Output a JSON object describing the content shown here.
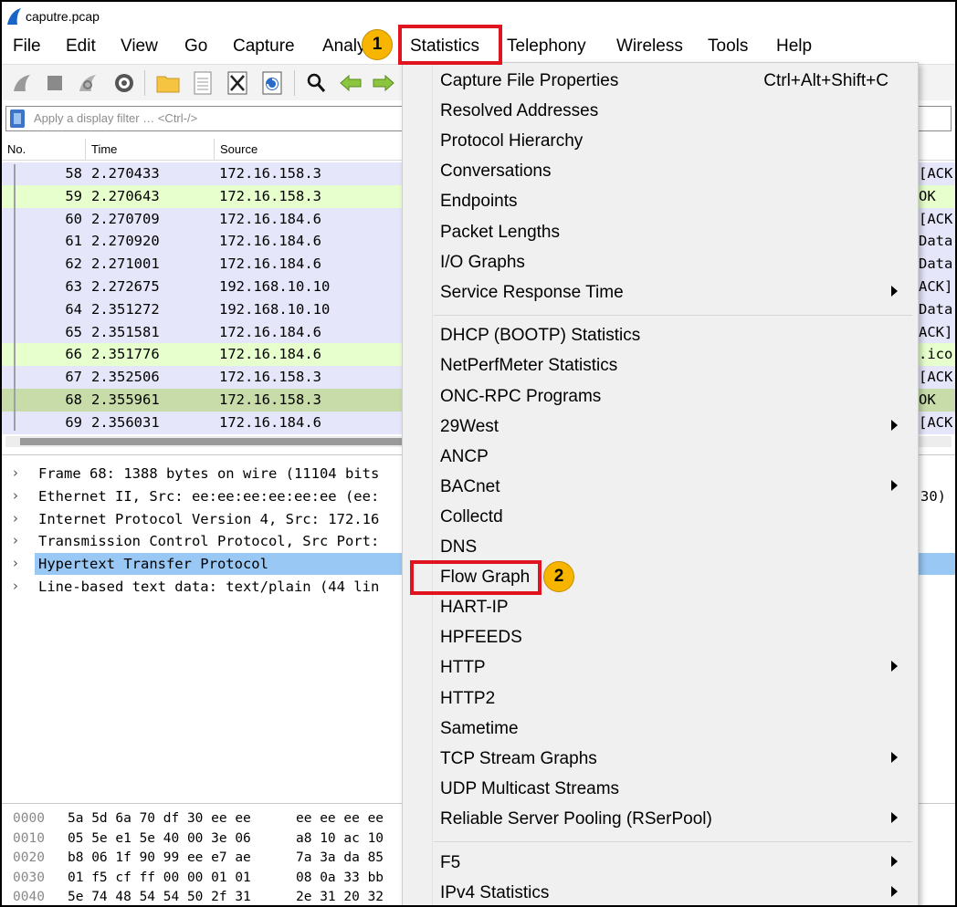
{
  "window": {
    "title": "caputre.pcap"
  },
  "menu": {
    "file": "File",
    "edit": "Edit",
    "view": "View",
    "go": "Go",
    "capture": "Capture",
    "analyze": "Analy",
    "statistics": "Statistics",
    "telephony": "Telephony",
    "wireless": "Wireless",
    "tools": "Tools",
    "help": "Help"
  },
  "filter": {
    "placeholder": "Apply a display filter … <Ctrl-/>"
  },
  "packet_list": {
    "headers": {
      "no": "No.",
      "time": "Time",
      "source": "Source"
    },
    "rows": [
      {
        "no": "58",
        "time": "2.270433",
        "source": "172.16.158.3",
        "info": "[ACK",
        "color": "#e6e6fa"
      },
      {
        "no": "59",
        "time": "2.270643",
        "source": "172.16.158.3",
        "info": "OK",
        "color": "#e6ffcc"
      },
      {
        "no": "60",
        "time": "2.270709",
        "source": "172.16.184.6",
        "info": "[ACK",
        "color": "#e6e6fa"
      },
      {
        "no": "61",
        "time": "2.270920",
        "source": "172.16.184.6",
        "info": "Data",
        "color": "#e6e6fa"
      },
      {
        "no": "62",
        "time": "2.271001",
        "source": "172.16.184.6",
        "info": "Data",
        "color": "#e6e6fa"
      },
      {
        "no": "63",
        "time": "2.272675",
        "source": "192.168.10.10",
        "info": "ACK]",
        "color": "#e6e6fa"
      },
      {
        "no": "64",
        "time": "2.351272",
        "source": "192.168.10.10",
        "info": "Data",
        "color": "#e6e6fa"
      },
      {
        "no": "65",
        "time": "2.351581",
        "source": "172.16.184.6",
        "info": "ACK]",
        "color": "#e6e6fa"
      },
      {
        "no": "66",
        "time": "2.351776",
        "source": "172.16.184.6",
        "info": ".ico",
        "color": "#e6ffcc"
      },
      {
        "no": "67",
        "time": "2.352506",
        "source": "172.16.158.3",
        "info": "[ACK",
        "color": "#e6e6fa"
      },
      {
        "no": "68",
        "time": "2.355961",
        "source": "172.16.158.3",
        "info": "OK",
        "color": "#c8dcaa"
      },
      {
        "no": "69",
        "time": "2.356031",
        "source": "172.16.184.6",
        "info": "[ACK",
        "color": "#e6e6fa"
      }
    ]
  },
  "details": {
    "rows": [
      {
        "text": "Frame 68: 1388 bytes on wire (11104 bits",
        "tail": ""
      },
      {
        "text": "Ethernet II, Src: ee:ee:ee:ee:ee:ee (ee:",
        "tail": "30)"
      },
      {
        "text": "Internet Protocol Version 4, Src: 172.16",
        "tail": ""
      },
      {
        "text": "Transmission Control Protocol, Src Port:",
        "tail": ""
      },
      {
        "text": "Hypertext Transfer Protocol",
        "tail": ""
      },
      {
        "text": "Line-based text data: text/plain (44 lin",
        "tail": ""
      }
    ],
    "selected_index": 4
  },
  "bytes": {
    "rows": [
      {
        "offset": "0000",
        "hex1": "5a 5d 6a 70 df 30 ee ee",
        "hex2": "ee ee ee ee"
      },
      {
        "offset": "0010",
        "hex1": "05 5e e1 5e 40 00 3e 06",
        "hex2": "a8 10 ac 10"
      },
      {
        "offset": "0020",
        "hex1": "b8 06 1f 90 99 ee e7 ae",
        "hex2": "7a 3a da 85"
      },
      {
        "offset": "0030",
        "hex1": "01 f5 cf ff 00 00 01 01",
        "hex2": "08 0a 33 bb"
      },
      {
        "offset": "0040",
        "hex1": "5e 74 48 54 54 50 2f 31",
        "hex2": "2e 31 20 32"
      }
    ]
  },
  "statistics_menu": {
    "items": [
      {
        "label": "Capture File Properties",
        "accel": "Ctrl+Alt+Shift+C",
        "submenu": false
      },
      {
        "label": "Resolved Addresses",
        "accel": "",
        "submenu": false
      },
      {
        "label": "Protocol Hierarchy",
        "accel": "",
        "submenu": false
      },
      {
        "label": "Conversations",
        "accel": "",
        "submenu": false
      },
      {
        "label": "Endpoints",
        "accel": "",
        "submenu": false
      },
      {
        "label": "Packet Lengths",
        "accel": "",
        "submenu": false
      },
      {
        "label": "I/O Graphs",
        "accel": "",
        "submenu": false
      },
      {
        "label": "Service Response Time",
        "accel": "",
        "submenu": true
      },
      {
        "label": "DHCP (BOOTP) Statistics",
        "accel": "",
        "submenu": false
      },
      {
        "label": "NetPerfMeter Statistics",
        "accel": "",
        "submenu": false
      },
      {
        "label": "ONC-RPC Programs",
        "accel": "",
        "submenu": false
      },
      {
        "label": "29West",
        "accel": "",
        "submenu": true
      },
      {
        "label": "ANCP",
        "accel": "",
        "submenu": false
      },
      {
        "label": "BACnet",
        "accel": "",
        "submenu": true
      },
      {
        "label": "Collectd",
        "accel": "",
        "submenu": false
      },
      {
        "label": "DNS",
        "accel": "",
        "submenu": false
      },
      {
        "label": "Flow Graph",
        "accel": "",
        "submenu": false
      },
      {
        "label": "HART-IP",
        "accel": "",
        "submenu": false
      },
      {
        "label": "HPFEEDS",
        "accel": "",
        "submenu": false
      },
      {
        "label": "HTTP",
        "accel": "",
        "submenu": true
      },
      {
        "label": "HTTP2",
        "accel": "",
        "submenu": false
      },
      {
        "label": "Sametime",
        "accel": "",
        "submenu": false
      },
      {
        "label": "TCP Stream Graphs",
        "accel": "",
        "submenu": true
      },
      {
        "label": "UDP Multicast Streams",
        "accel": "",
        "submenu": false
      },
      {
        "label": "Reliable Server Pooling (RSerPool)",
        "accel": "",
        "submenu": true
      },
      {
        "label": "F5",
        "accel": "",
        "submenu": true
      },
      {
        "label": "IPv4 Statistics",
        "accel": "",
        "submenu": true
      }
    ]
  },
  "annotations": {
    "step1": "1",
    "step2": "2",
    "highlight_color": "#e0141e",
    "badge_color": "#f7b500"
  }
}
